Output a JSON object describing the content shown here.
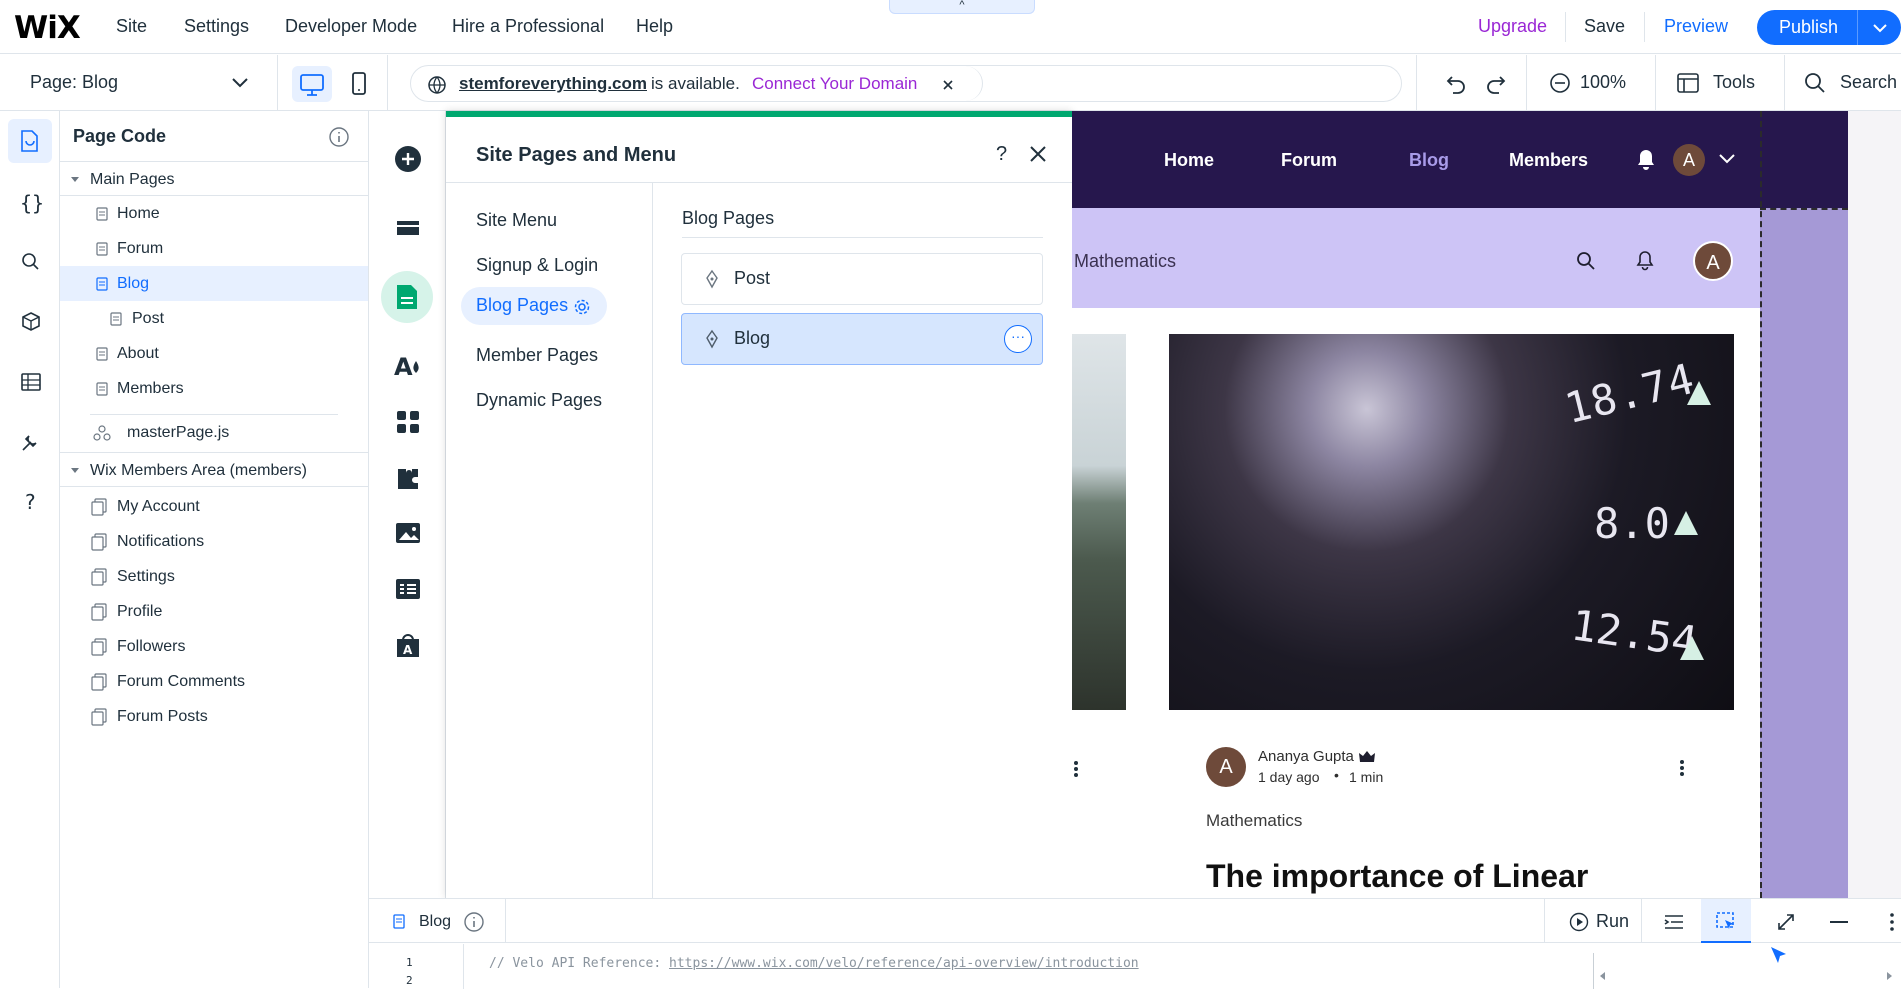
{
  "topbar": {
    "logo": "WiX",
    "menu": [
      "Site",
      "Settings",
      "Developer Mode",
      "Hire a Professional",
      "Help"
    ],
    "upgrade": "Upgrade",
    "save": "Save",
    "preview": "Preview",
    "publish": "Publish",
    "handle_glyph": "^"
  },
  "bar2": {
    "page_selector": "Page: Blog",
    "domain": "stemforeverything.com",
    "domain_status": "is available.",
    "connect_domain": "Connect Your Domain",
    "zoom": "100%",
    "tools": "Tools",
    "search": "Search"
  },
  "explorer": {
    "title": "Page Code",
    "main_pages_header": "Main Pages",
    "main_pages": [
      "Home",
      "Forum",
      "Blog",
      "Post",
      "About",
      "Members"
    ],
    "master_page": "masterPage.js",
    "members_header": "Wix Members Area (members)",
    "members_pages": [
      "My Account",
      "Notifications",
      "Settings",
      "Profile",
      "Followers",
      "Forum Comments",
      "Forum Posts"
    ]
  },
  "pages_panel": {
    "title": "Site Pages and Menu",
    "help": "?",
    "nav": [
      "Site Menu",
      "Signup & Login",
      "Blog Pages",
      "Member Pages",
      "Dynamic Pages"
    ],
    "selected_nav": "Blog Pages",
    "section_title": "Blog Pages",
    "items": [
      "Post",
      "Blog"
    ],
    "selected_item": "Blog"
  },
  "site": {
    "nav_links": [
      "Home",
      "Forum",
      "Blog",
      "Members"
    ],
    "active_link": "Blog",
    "avatar": "A",
    "category": "Mathematics",
    "author": "Ananya Gupta",
    "meta": "1 day ago",
    "read_time": "1 min",
    "post_category": "Mathematics",
    "post_title": "The importance of Linear",
    "ticker": [
      "18.74",
      "8.0",
      "12.54"
    ],
    "colors": {
      "nav": "#26174d",
      "subheader": "#cdc4f6",
      "active_link": "#a89be8"
    }
  },
  "code": {
    "file": "Blog",
    "run": "Run",
    "line_numbers": [
      "1",
      "2"
    ],
    "comment_prefix": "// Velo API Reference: ",
    "comment_link": "https://www.wix.com/velo/reference/api-overview/introduction"
  }
}
